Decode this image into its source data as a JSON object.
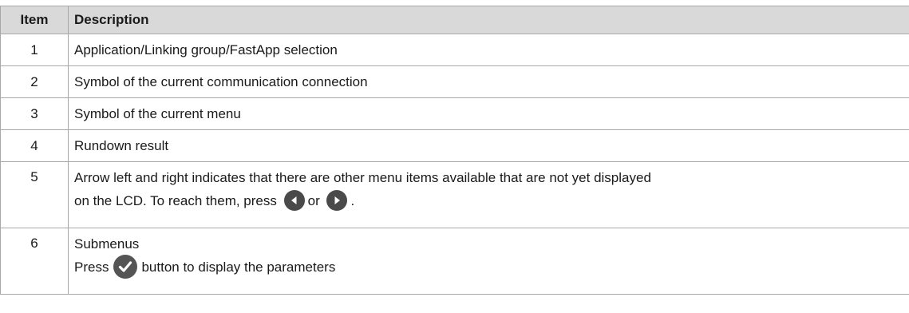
{
  "table": {
    "headers": {
      "item": "Item",
      "description": "Description"
    },
    "rows": [
      {
        "item": "1",
        "description": "Application/Linking group/FastApp selection"
      },
      {
        "item": "2",
        "description": "Symbol of the current communication connection"
      },
      {
        "item": "3",
        "description": "Symbol of the current menu"
      },
      {
        "item": "4",
        "description": "Rundown result"
      },
      {
        "item": "5",
        "description_line1": "Arrow left and right indicates that there are other menu items available that are not yet displayed",
        "description_line2_pre": "on the LCD. To reach them, press",
        "description_line2_mid": "or",
        "description_line2_post": ".",
        "icons": [
          "arrow-left-button-icon",
          "arrow-right-button-icon"
        ]
      },
      {
        "item": "6",
        "description_line1": "Submenus",
        "description_line2_pre": "Press",
        "description_line2_post": "button to display the parameters",
        "icons": [
          "checkmark-button-icon"
        ]
      }
    ]
  },
  "colors": {
    "header_bg": "#d9d9d9",
    "border": "#a8a8a8",
    "icon_fill": "#4a4a4a"
  }
}
